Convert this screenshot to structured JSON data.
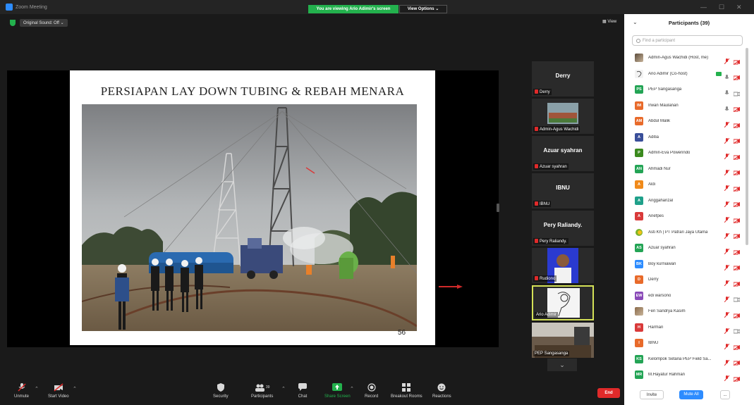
{
  "window": {
    "title": "Zoom Meeting",
    "viewing_banner": "You are viewing Ario Adimir's screen",
    "view_options": "View Options ⌄"
  },
  "meeting_bar": {
    "audio_label": "Original Sound: Off",
    "view_label": "View"
  },
  "slide": {
    "title": "PERSIAPAN LAY DOWN TUBING & REBAH MENARA",
    "page_number": "56"
  },
  "gallery": {
    "tiles": [
      {
        "big_name": "Derry",
        "label": "Derry",
        "muted": true,
        "kind": "name"
      },
      {
        "big_name": "",
        "label": "Admin-Agus Wachidi",
        "muted": true,
        "kind": "building"
      },
      {
        "big_name": "Azuar syahran",
        "label": "Azuar syahran",
        "muted": true,
        "kind": "name"
      },
      {
        "big_name": "IBNU",
        "label": "IBNU",
        "muted": true,
        "kind": "name"
      },
      {
        "big_name": "Pery Raliandy.",
        "label": "Pery Raliandy.",
        "muted": true,
        "kind": "name"
      },
      {
        "big_name": "",
        "label": "Rudiono",
        "muted": true,
        "kind": "portrait"
      },
      {
        "big_name": "",
        "label": "Ario Adimir",
        "muted": false,
        "kind": "sketch"
      },
      {
        "big_name": "",
        "label": "PEP Sangasanga",
        "muted": false,
        "kind": "room"
      }
    ]
  },
  "toolbar": {
    "unmute": "Unmute",
    "start_video": "Start Video",
    "security": "Security",
    "participants": "Participants",
    "participants_count": "39",
    "chat": "Chat",
    "share_screen": "Share Screen",
    "record": "Record",
    "breakout_rooms": "Breakout Rooms",
    "reactions": "Reactions",
    "end": "End"
  },
  "panel": {
    "title": "Participants (39)",
    "search_placeholder": "Find a participant",
    "invite": "Invite",
    "mute_all": "Mute All",
    "more": "...",
    "participants": [
      {
        "initials": "",
        "name": "Admin-Agus Wachidi (Host, me)",
        "color": "#5a4a3a",
        "mic": "muted",
        "video": "off",
        "avatar": "photo"
      },
      {
        "initials": "",
        "name": "Ario Adimir (Co-host)",
        "color": "#bbbbbb",
        "mic": "on",
        "video": "off",
        "avatar": "sketch",
        "sharing": true
      },
      {
        "initials": "PS",
        "name": "PEP Sangasanga",
        "color": "#23a455",
        "mic": "on",
        "video": "on",
        "avatar": "initials"
      },
      {
        "initials": "IM",
        "name": "Irwan Maulanan",
        "color": "#e86a2a",
        "mic": "on",
        "video": "off",
        "avatar": "initials"
      },
      {
        "initials": "AM",
        "name": "Abdul Malik",
        "color": "#e86a2a",
        "mic": "muted",
        "video": "off",
        "avatar": "initials"
      },
      {
        "initials": "A",
        "name": "Aditia",
        "color": "#3a4f9a",
        "mic": "muted",
        "video": "off",
        "avatar": "initials"
      },
      {
        "initials": "P",
        "name": "Admin-Eva Powerindo",
        "color": "#3b8a1e",
        "mic": "muted",
        "video": "off",
        "avatar": "initials"
      },
      {
        "initials": "AN",
        "name": "Ahmadi Nur",
        "color": "#23a455",
        "mic": "muted",
        "video": "off",
        "avatar": "initials"
      },
      {
        "initials": "A",
        "name": "Aldi",
        "color": "#f08a1a",
        "mic": "muted",
        "video": "off",
        "avatar": "initials"
      },
      {
        "initials": "A",
        "name": "Anggaharizal",
        "color": "#1fa08a",
        "mic": "muted",
        "video": "off",
        "avatar": "initials"
      },
      {
        "initials": "A",
        "name": "Ariefpes",
        "color": "#d93a3a",
        "mic": "muted",
        "video": "off",
        "avatar": "initials"
      },
      {
        "initials": "",
        "name": "Asti Kh | PT Patrari Jaya Utama",
        "color": "#7ab32a",
        "mic": "muted",
        "video": "off",
        "avatar": "logo"
      },
      {
        "initials": "AS",
        "name": "Azuar syahran",
        "color": "#23a455",
        "mic": "muted",
        "video": "off",
        "avatar": "initials"
      },
      {
        "initials": "BK",
        "name": "Boy kurniawan",
        "color": "#2d8cff",
        "mic": "muted",
        "video": "off",
        "avatar": "initials"
      },
      {
        "initials": "D",
        "name": "Derry",
        "color": "#e86a2a",
        "mic": "muted",
        "video": "off",
        "avatar": "initials"
      },
      {
        "initials": "EW",
        "name": "edi warsono",
        "color": "#8a4ab8",
        "mic": "muted",
        "video": "on",
        "avatar": "initials"
      },
      {
        "initials": "",
        "name": "Feri Sandrya Kasim",
        "color": "#8a6a4a",
        "mic": "muted",
        "video": "off",
        "avatar": "photo2"
      },
      {
        "initials": "H",
        "name": "Harman",
        "color": "#d93a3a",
        "mic": "muted",
        "video": "on",
        "avatar": "initials"
      },
      {
        "initials": "I",
        "name": "IBNU",
        "color": "#e86a2a",
        "mic": "muted",
        "video": "off",
        "avatar": "initials"
      },
      {
        "initials": "KS",
        "name": "Kelompok Setaria PEP Field Sa...",
        "color": "#23a455",
        "mic": "muted",
        "video": "off",
        "avatar": "initials"
      },
      {
        "initials": "MR",
        "name": "M.Hayatur Rahman",
        "color": "#23a455",
        "mic": "muted",
        "video": "off",
        "avatar": "initials"
      }
    ]
  }
}
